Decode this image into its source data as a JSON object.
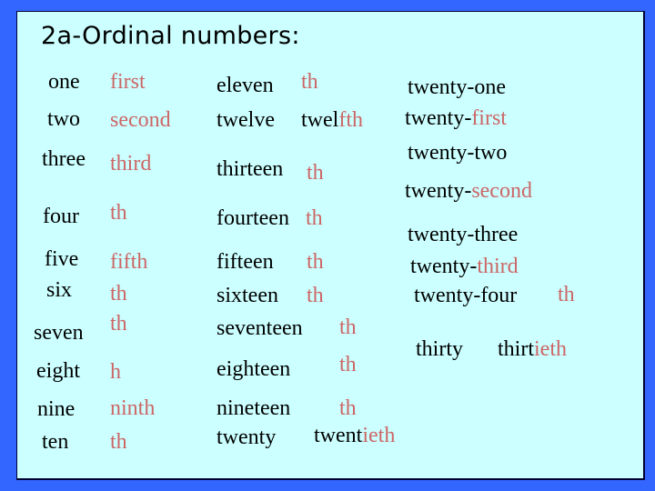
{
  "slide": {
    "title": "2a-Ordinal numbers:",
    "colors": {
      "background": "#3366ff",
      "panel": "#ccffff",
      "text": "#000000",
      "suffix": "#cc6666"
    },
    "col1": [
      {
        "cardinal": "one",
        "ordinal_prefix": "",
        "ordinal_suffix": "first"
      },
      {
        "cardinal": "two",
        "ordinal_prefix": "",
        "ordinal_suffix": "second"
      },
      {
        "cardinal": "three",
        "ordinal_prefix": "",
        "ordinal_suffix": "third"
      },
      {
        "cardinal": "four",
        "ordinal_prefix": "",
        "ordinal_suffix": "th"
      },
      {
        "cardinal": "five",
        "ordinal_prefix": "",
        "ordinal_suffix": "fifth"
      },
      {
        "cardinal": "six",
        "ordinal_prefix": "",
        "ordinal_suffix": "th"
      },
      {
        "cardinal": "seven",
        "ordinal_prefix": "",
        "ordinal_suffix": "th"
      },
      {
        "cardinal": "eight",
        "ordinal_prefix": "",
        "ordinal_suffix": "h"
      },
      {
        "cardinal": "nine",
        "ordinal_prefix": "",
        "ordinal_suffix": "ninth"
      },
      {
        "cardinal": "ten",
        "ordinal_prefix": "",
        "ordinal_suffix": "th"
      }
    ],
    "col2": [
      {
        "cardinal": "eleven",
        "ordinal_prefix": "",
        "ordinal_suffix": "th"
      },
      {
        "cardinal": "twelve",
        "ordinal_prefix": "twel",
        "ordinal_suffix": "fth"
      },
      {
        "cardinal": "thirteen",
        "ordinal_prefix": "",
        "ordinal_suffix": "th"
      },
      {
        "cardinal": "fourteen",
        "ordinal_prefix": "",
        "ordinal_suffix": "th"
      },
      {
        "cardinal": "fifteen",
        "ordinal_prefix": "",
        "ordinal_suffix": "th"
      },
      {
        "cardinal": "sixteen",
        "ordinal_prefix": "",
        "ordinal_suffix": "th"
      },
      {
        "cardinal": "seventeen",
        "ordinal_prefix": "",
        "ordinal_suffix": "th"
      },
      {
        "cardinal": "eighteen",
        "ordinal_prefix": "",
        "ordinal_suffix": "th"
      },
      {
        "cardinal": "nineteen",
        "ordinal_prefix": "",
        "ordinal_suffix": "th"
      },
      {
        "cardinal": "twenty",
        "ordinal_prefix": "twent",
        "ordinal_suffix": "ieth"
      }
    ],
    "col3": [
      {
        "prefix": "twenty-",
        "suffix": "one",
        "suffix_red": false
      },
      {
        "prefix": "twenty-",
        "suffix": "first",
        "suffix_red": true
      },
      {
        "prefix": "twenty-",
        "suffix": "two",
        "suffix_red": false
      },
      {
        "prefix": "twenty-",
        "suffix": "second",
        "suffix_red": true
      },
      {
        "prefix": "twenty-",
        "suffix": "three",
        "suffix_red": false
      },
      {
        "prefix": "twenty-",
        "suffix": "third",
        "suffix_red": true
      },
      {
        "prefix": "twenty-four",
        "suffix": "th",
        "suffix_red": true
      }
    ],
    "thirty": {
      "cardinal": "thirty",
      "ordinal_prefix": "thirt",
      "ordinal_suffix": "ieth"
    }
  }
}
